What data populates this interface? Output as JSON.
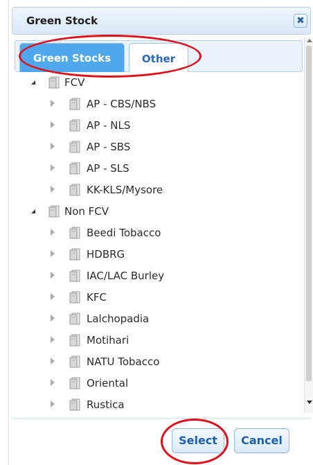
{
  "dialog": {
    "title": "Green Stock",
    "close_icon": "close-icon"
  },
  "tabs": [
    {
      "label": "Green Stocks",
      "active": true
    },
    {
      "label": "Other",
      "active": false
    }
  ],
  "tree": {
    "groups": [
      {
        "label": "FCV",
        "expanded": true,
        "children": [
          "AP - CBS/NBS",
          "AP - NLS",
          "AP - SBS",
          "AP - SLS",
          "KK-KLS/Mysore"
        ]
      },
      {
        "label": "Non FCV",
        "expanded": true,
        "children": [
          "Beedi Tobacco",
          "HDBRG",
          "IAC/LAC Burley",
          "KFC",
          "Lalchopadia",
          "Motihari",
          "NATU Tobacco",
          "Oriental",
          "Rustica"
        ]
      }
    ]
  },
  "footer": {
    "select_label": "Select",
    "cancel_label": "Cancel"
  },
  "colors": {
    "active_tab": "#4fa8eb",
    "highlight_circle": "#e0101a",
    "button_text": "#1e5fa8"
  }
}
